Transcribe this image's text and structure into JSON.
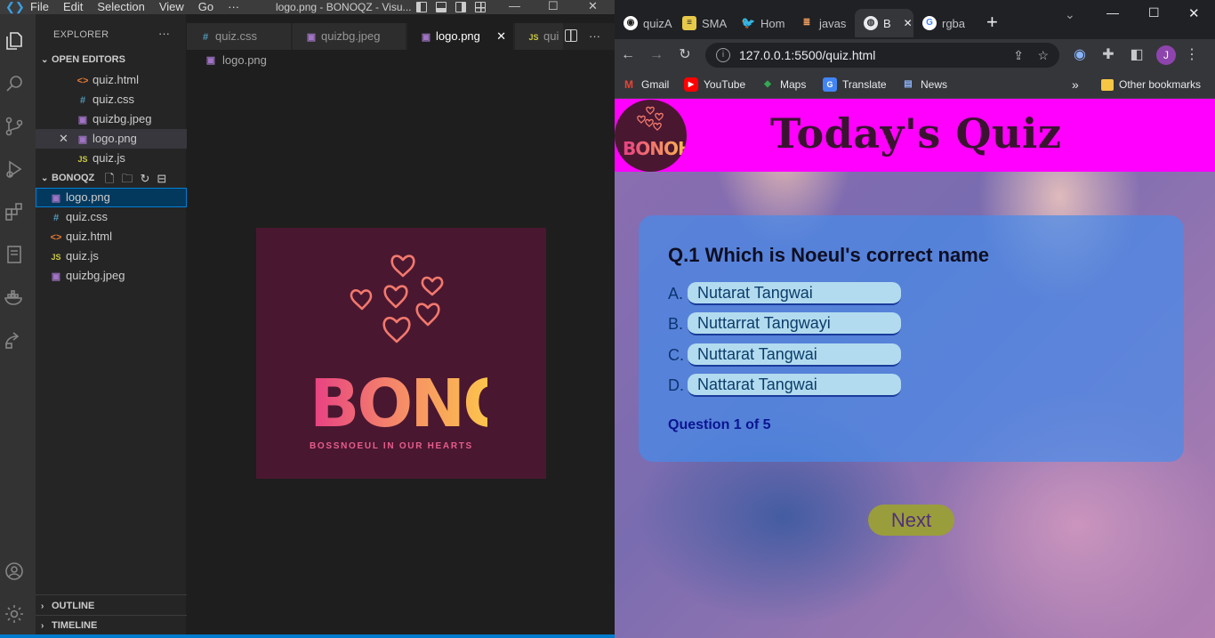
{
  "vscode": {
    "menu": [
      "File",
      "Edit",
      "Selection",
      "View",
      "Go",
      "···"
    ],
    "window_title": "logo.png - BONOQZ - Visu...",
    "explorer_title": "EXPLORER",
    "explorer_more": "···",
    "open_editors_title": "OPEN EDITORS",
    "open_editors": [
      {
        "name": "quiz.html",
        "icon": "html-icon",
        "glyph": "<>"
      },
      {
        "name": "quiz.css",
        "icon": "css-icon",
        "glyph": "#"
      },
      {
        "name": "quizbg.jpeg",
        "icon": "image-icon",
        "glyph": "▣"
      },
      {
        "name": "logo.png",
        "icon": "image-icon",
        "glyph": "▣",
        "close": "✕"
      },
      {
        "name": "quiz.js",
        "icon": "js-icon",
        "glyph": "JS"
      }
    ],
    "folder_title": "BONOQZ",
    "files": [
      {
        "name": "logo.png",
        "icon": "image-icon",
        "glyph": "▣"
      },
      {
        "name": "quiz.css",
        "icon": "css-icon",
        "glyph": "#"
      },
      {
        "name": "quiz.html",
        "icon": "html-icon",
        "glyph": "<>"
      },
      {
        "name": "quiz.js",
        "icon": "js-icon",
        "glyph": "JS"
      },
      {
        "name": "quizbg.jpeg",
        "icon": "image-icon",
        "glyph": "▣"
      }
    ],
    "outline_title": "OUTLINE",
    "timeline_title": "TIMELINE",
    "tabs": [
      {
        "name": "quiz.css",
        "glyph": "#"
      },
      {
        "name": "quizbg.jpeg",
        "glyph": "▣"
      },
      {
        "name": "logo.png",
        "glyph": "▣",
        "close": "✕"
      },
      {
        "name": "qui",
        "glyph": "JS"
      }
    ],
    "tabs_more": "···",
    "breadcrumb": "logo.png",
    "logo": {
      "brand": "BONOH",
      "tagline": "BOSSNOEUL IN OUR HEARTS"
    }
  },
  "chrome": {
    "tabs": [
      "quizA",
      "SMA",
      "Hom",
      "javas",
      "B",
      "rgba"
    ],
    "active_close": "✕",
    "new_tab": "+",
    "url": "127.0.0.1:5500/quiz.html",
    "profile_initial": "J",
    "bookmarks": [
      "Gmail",
      "YouTube",
      "Maps",
      "Translate",
      "News"
    ],
    "bookmarks_more": "»",
    "other_bookmarks": "Other bookmarks"
  },
  "page": {
    "title": "Today's Quiz",
    "logo_brand": "BONOH",
    "question": "Q.1 Which is Noeul's correct name",
    "options": [
      {
        "letter": "A.",
        "text": "Nutarat Tangwai"
      },
      {
        "letter": "B.",
        "text": "Nuttarrat Tangwayi"
      },
      {
        "letter": "C.",
        "text": "Nuttarat Tangwai"
      },
      {
        "letter": "D.",
        "text": "Nattarat Tangwai"
      }
    ],
    "progress": "Question 1 of 5",
    "next_label": "Next"
  },
  "colors": {
    "header": "#ff00ff",
    "quiz_box": "#468ceb",
    "option_bg": "#b2dbef",
    "next_bg": "#9a9d3b",
    "vscode_accent": "#007acc"
  }
}
